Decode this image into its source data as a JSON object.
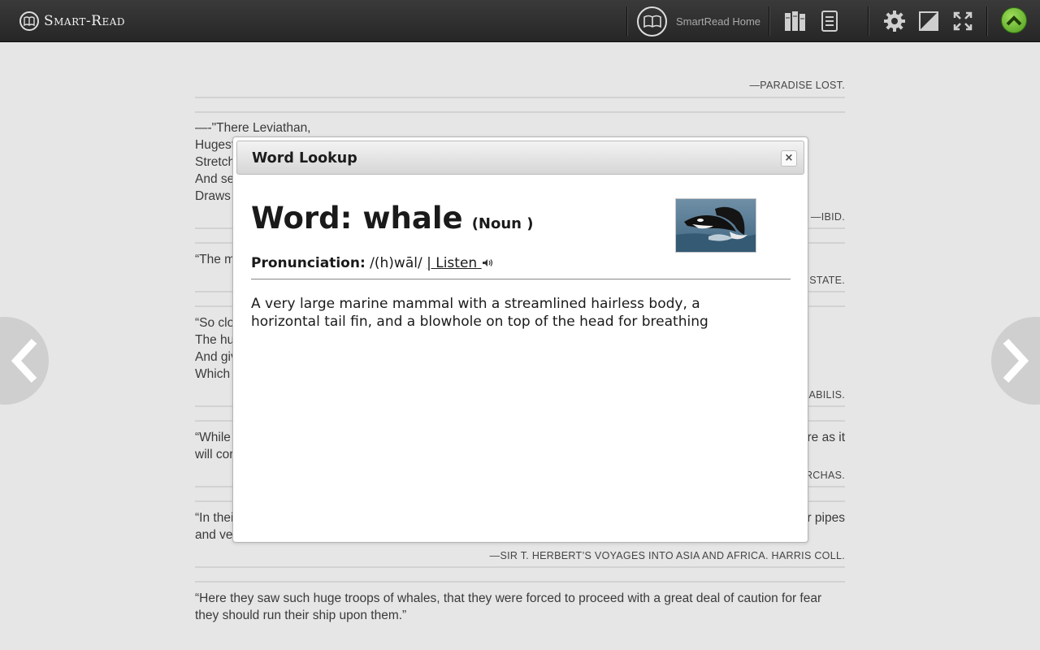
{
  "app": {
    "logo_text": "Smart-Read",
    "home_label": "SmartRead Home"
  },
  "toolbar": {
    "icons": [
      "library-icon",
      "notes-icon",
      "settings-icon",
      "contrast-icon",
      "fullscreen-icon",
      "scroll-top-icon"
    ]
  },
  "page": {
    "entries": [
      {
        "attribution": "—Paradise Lost."
      },
      {
        "text": "—-\"There Leviathan,\nHugest\nStretch\nAnd se\nDraws",
        "attribution": "—Ibid."
      },
      {
        "text": "“The m",
        "attribution": "State."
      },
      {
        "text": "“So clo\nThe hu\nAnd giv\nWhich",
        "attribution": "rabilis."
      },
      {
        "text": "“While",
        "text_right": "re as it",
        "text2": "will cor",
        "attribution": "rchas."
      },
      {
        "text": "“In thei",
        "text_right": "r pipes",
        "text2": "and ve",
        "attribution": "—Sir T. Herbert’s voyages into Asia and Africa. Harris Coll."
      },
      {
        "text": "“Here they saw such huge troops of whales, that they were forced to proceed with a great deal of caution for fear they should run their ship upon them.”"
      }
    ]
  },
  "modal": {
    "title": "Word Lookup",
    "close_label": "×",
    "word_label": "Word: whale",
    "part_of_speech": "(Noun )",
    "pronunciation_label": "Pronunciation:",
    "pronunciation": "/(h)wāl/",
    "listen_label": "| Listen",
    "definition": "A very large marine mammal with a streamlined hairless body, a horizontal tail fin, and a blowhole on top of the head for breathing"
  }
}
